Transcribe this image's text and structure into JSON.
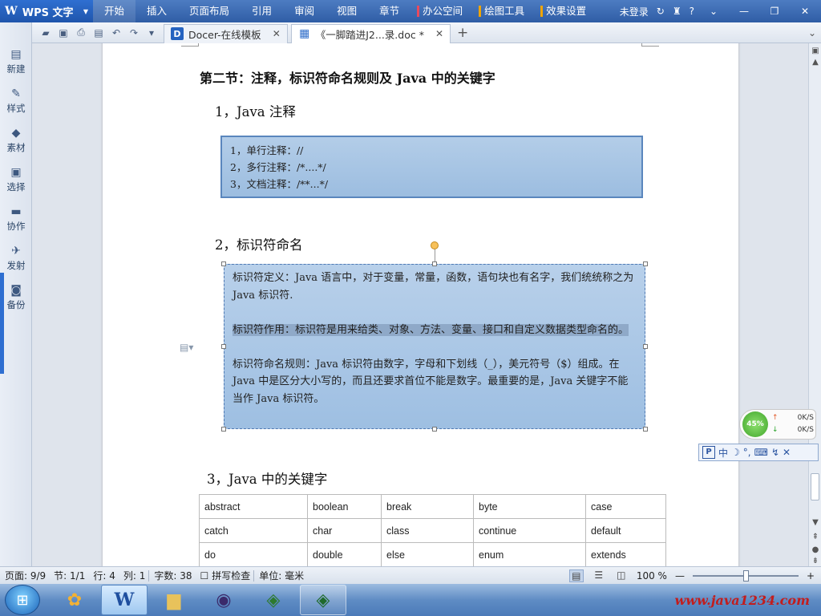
{
  "app": {
    "logo_glyph": "W",
    "name": "WPS 文字",
    "menu": [
      "开始",
      "插入",
      "页面布局",
      "引用",
      "审阅",
      "视图",
      "章节"
    ],
    "tools": [
      {
        "label": "办公空间",
        "color": "#e84a5f"
      },
      {
        "label": "绘图工具",
        "color": "#f0a500"
      },
      {
        "label": "效果设置",
        "color": "#f0a500"
      }
    ],
    "login": "未登录",
    "help": "?",
    "colors": {
      "title_bar": "#3a68b0",
      "selection": "#9ebfe2"
    }
  },
  "tabs": [
    {
      "icon_glyph": "D",
      "label": "Docer-在线模板",
      "close": "✕"
    },
    {
      "label": "《一脚踏进J2...录.doc *",
      "close": "✕"
    }
  ],
  "tab_add": "+",
  "sidebar": [
    {
      "icon": "new-doc-icon",
      "label": "新建"
    },
    {
      "icon": "style-icon",
      "label": "样式"
    },
    {
      "icon": "material-icon",
      "label": "素材"
    },
    {
      "icon": "select-icon",
      "label": "选择"
    },
    {
      "icon": "collab-icon",
      "label": "协作"
    },
    {
      "icon": "send-icon",
      "label": "发射"
    },
    {
      "icon": "backup-icon",
      "label": "备份"
    }
  ],
  "doc": {
    "section_title": "第二节：注释，标识符命名规则及 Java 中的关键字",
    "h1": "1，Java 注释",
    "comments": [
      "1，单行注释：//",
      "2，多行注释：/*....*/",
      "3，文档注释：/**...*/"
    ],
    "h2": "2，标识符命名",
    "ident_def": "标识符定义：Java 语言中，对于变量，常量，函数，语句块也有名字，我们统统称之为 Java 标识符.",
    "ident_use": "标识符作用：标识符是用来给类、对象、方法、变量、接口和自定义数据类型命名的。",
    "ident_rule": "标识符命名规则：Java 标识符由数字，字母和下划线（_），美元符号（$）组成。在 Java 中是区分大小写的，而且还要求首位不能是数字。最重要的是，Java 关键字不能当作 Java 标识符。",
    "h3": "3，Java 中的关键字",
    "keywords": [
      [
        "abstract",
        "boolean",
        "break",
        "byte",
        "case"
      ],
      [
        "catch",
        "char",
        "class",
        "continue",
        "default"
      ],
      [
        "do",
        "double",
        "else",
        "enum",
        "extends"
      ]
    ]
  },
  "net_widget": {
    "percent": "45%",
    "up": "0K/S",
    "down": "0K/S"
  },
  "ime": {
    "logo": "P",
    "mode": "中"
  },
  "status": {
    "page": "页面: 9/9",
    "section": "节: 1/1",
    "line": "行: 4",
    "col": "列: 1",
    "chars": "字数: 38",
    "spell": "拼写检查",
    "unit": "单位: 毫米",
    "zoom": "100 %",
    "zoom_fraction": 0.5
  },
  "taskbar": {
    "watermark": "www.java1234.com"
  }
}
